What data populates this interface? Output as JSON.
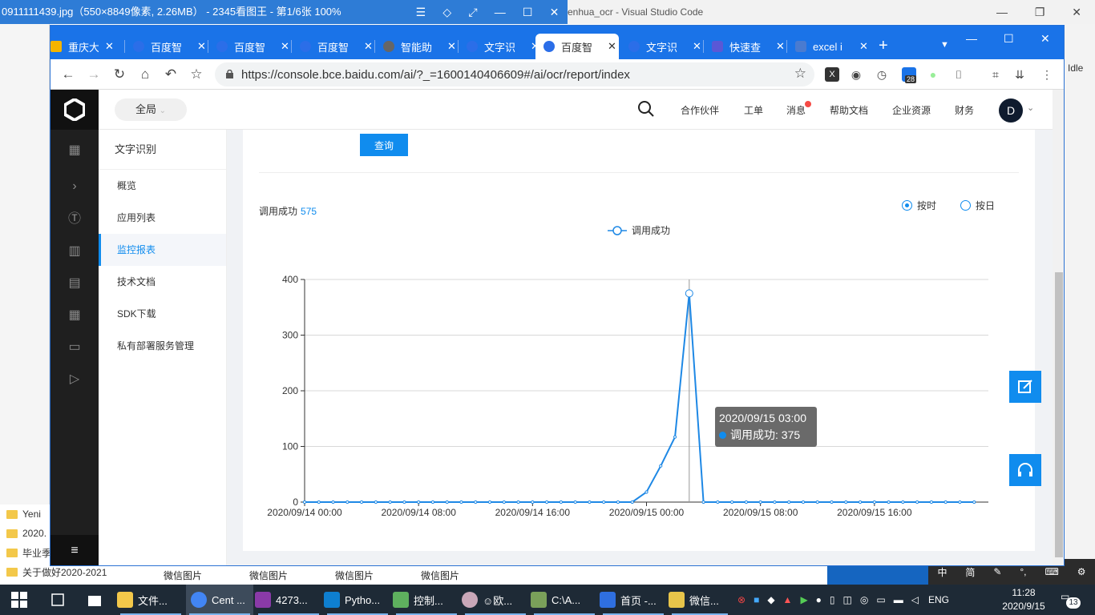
{
  "background": {
    "image_viewer_title": "0911111439.jpg（550×8849像素, 2.26MB） - 2345看图王 - 第1/6张 100%",
    "vscode_title": "enhua_ocr - Visual Studio Code",
    "vscode_status": "t: Idle",
    "folders": [
      "2020.",
      "毕业季",
      "关于做好2020-2021"
    ],
    "folder_top": "Yeni",
    "wechat_images": [
      "微信图片",
      "微信图片",
      "微信图片",
      "微信图片"
    ],
    "tray_popup": [
      "中",
      "简"
    ]
  },
  "browser": {
    "tabs": [
      {
        "label": "重庆大",
        "color": "#f4b400",
        "close": "✕"
      },
      {
        "label": "百度智",
        "color": "#2b6ee8",
        "close": "✕"
      },
      {
        "label": "百度智",
        "color": "#2b6ee8",
        "close": "✕"
      },
      {
        "label": "百度智",
        "color": "#2b6ee8",
        "close": "✕"
      },
      {
        "label": "智能助",
        "color": "#666666",
        "close": "✕"
      },
      {
        "label": "文字识",
        "color": "#2b6ee8",
        "close": "✕"
      },
      {
        "label": "百度智",
        "color": "#2b6ee8",
        "close": "✕"
      },
      {
        "label": "文字识",
        "color": "#2b6ee8",
        "close": "✕"
      },
      {
        "label": "快速查",
        "color": "#5a58d6",
        "close": "✕"
      },
      {
        "label": "excel i",
        "color": "#4a7bd0",
        "close": "✕"
      }
    ],
    "new_tab": "+",
    "url": "https://console.bce.baidu.com/ai/?_=1600140406609#/ai/ocr/report/index",
    "extension_badge": "28"
  },
  "console": {
    "region": "全局",
    "top_nav": [
      "合作伙伴",
      "工单",
      "消息",
      "帮助文档",
      "企业资源",
      "财务"
    ],
    "avatar_letter": "D",
    "submenu_title": "文字识别",
    "submenu_items": [
      "概览",
      "应用列表",
      "监控报表",
      "技术文档",
      "SDK下载",
      "私有部署服务管理"
    ],
    "active_submenu": 2,
    "query_button": "查询",
    "summary_label": "调用成功",
    "summary_count": "575",
    "radio_hourly": "按时",
    "radio_daily": "按日",
    "legend_label": "调用成功",
    "tooltip": {
      "title": "2020/09/15 03:00",
      "label": "调用成功: 375"
    }
  },
  "chart_data": {
    "type": "line",
    "title": "",
    "series": [
      {
        "name": "调用成功",
        "x": [
          "2020/09/14 00:00",
          "2020/09/14 01:00",
          "2020/09/14 02:00",
          "2020/09/14 03:00",
          "2020/09/14 04:00",
          "2020/09/14 05:00",
          "2020/09/14 06:00",
          "2020/09/14 07:00",
          "2020/09/14 08:00",
          "2020/09/14 09:00",
          "2020/09/14 10:00",
          "2020/09/14 11:00",
          "2020/09/14 12:00",
          "2020/09/14 13:00",
          "2020/09/14 14:00",
          "2020/09/14 15:00",
          "2020/09/14 16:00",
          "2020/09/14 17:00",
          "2020/09/14 18:00",
          "2020/09/14 19:00",
          "2020/09/14 20:00",
          "2020/09/14 21:00",
          "2020/09/14 22:00",
          "2020/09/14 23:00",
          "2020/09/15 00:00",
          "2020/09/15 01:00",
          "2020/09/15 02:00",
          "2020/09/15 03:00",
          "2020/09/15 04:00",
          "2020/09/15 05:00",
          "2020/09/15 06:00",
          "2020/09/15 07:00",
          "2020/09/15 08:00",
          "2020/09/15 09:00",
          "2020/09/15 10:00",
          "2020/09/15 11:00",
          "2020/09/15 12:00",
          "2020/09/15 13:00",
          "2020/09/15 14:00",
          "2020/09/15 15:00",
          "2020/09/15 16:00",
          "2020/09/15 17:00",
          "2020/09/15 18:00",
          "2020/09/15 19:00",
          "2020/09/15 20:00",
          "2020/09/15 21:00",
          "2020/09/15 22:00",
          "2020/09/15 23:00"
        ],
        "values": [
          0,
          0,
          0,
          0,
          0,
          0,
          0,
          0,
          0,
          0,
          0,
          0,
          0,
          0,
          0,
          0,
          0,
          0,
          0,
          0,
          0,
          0,
          0,
          0,
          18,
          65,
          117,
          375,
          0,
          0,
          0,
          0,
          0,
          0,
          0,
          0,
          0,
          0,
          0,
          0,
          0,
          0,
          0,
          0,
          0,
          0,
          0,
          0
        ],
        "color": "#1e88e5"
      }
    ],
    "x_tick_labels": [
      "2020/09/14 00:00",
      "2020/09/14 08:00",
      "2020/09/14 16:00",
      "2020/09/15 00:00",
      "2020/09/15 08:00",
      "2020/09/15 16:00"
    ],
    "y_ticks": [
      0,
      100,
      200,
      300,
      400
    ],
    "ylim": [
      0,
      400
    ],
    "grid": true,
    "legend": "top-center",
    "highlight_x": "2020/09/15 03:00"
  },
  "taskbar": {
    "apps": [
      "文件...",
      "Cent ...",
      "4273...",
      "Pytho...",
      "控制...",
      "☺欧...",
      "C:\\A...",
      "首页 -...",
      "微信..."
    ],
    "lang": "ENG",
    "time": "11:28",
    "date": "2020/9/15",
    "notifications": "13"
  }
}
